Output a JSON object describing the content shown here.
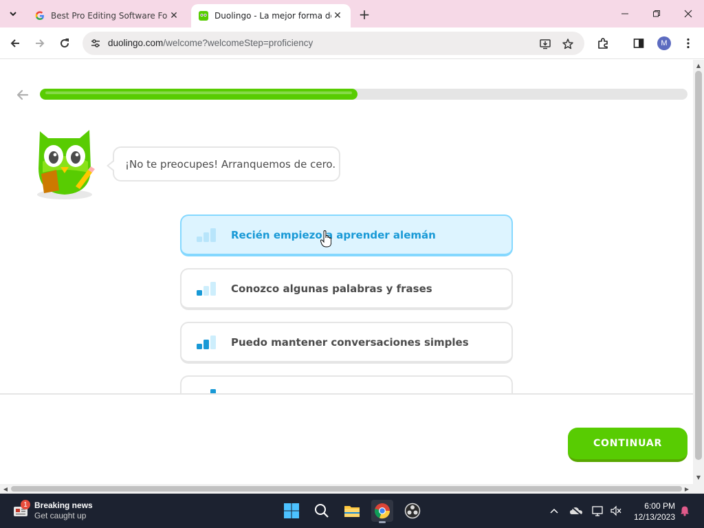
{
  "browser": {
    "tabs": [
      {
        "title": "Best Pro Editing Software For P",
        "active": false
      },
      {
        "title": "Duolingo - La mejor forma de a",
        "active": true
      }
    ],
    "url": {
      "domain": "duolingo.com",
      "path": "/welcome?welcomeStep=proficiency"
    },
    "profile_initial": "M"
  },
  "page": {
    "progress": 0.49,
    "speech_bubble": "¡No te preocupes! Arranquemos de cero.",
    "options": [
      {
        "label": "Recién empiezo a aprender alemán",
        "level": 0,
        "selected": true
      },
      {
        "label": "Conozco algunas palabras y frases",
        "level": 1,
        "selected": false
      },
      {
        "label": "Puedo mantener conversaciones simples",
        "level": 2,
        "selected": false
      },
      {
        "label": "",
        "level": 3,
        "selected": false
      }
    ],
    "continue_label": "CONTINUAR"
  },
  "taskbar": {
    "news_badge": "1",
    "news_title": "Breaking news",
    "news_subtitle": "Get caught up",
    "time": "6:00 PM",
    "date": "12/13/2023"
  },
  "colors": {
    "brand_green": "#58cc02",
    "selected_blue": "#1899d6",
    "selected_bg": "#ddf4ff"
  }
}
